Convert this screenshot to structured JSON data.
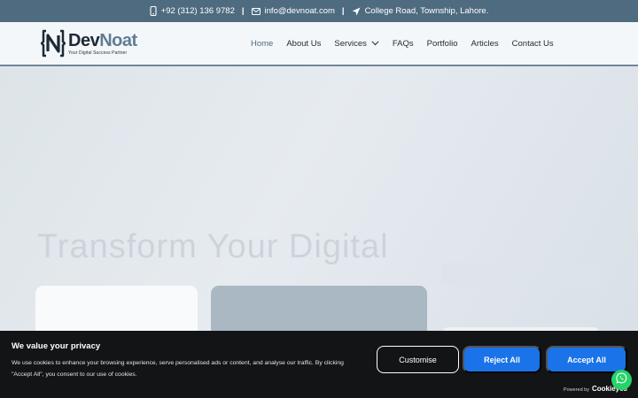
{
  "topbar": {
    "phone": "+92 (312) 136 9782",
    "email": "info@devnoat.com",
    "address": "College Road, Township, Lahore.",
    "separator": "|"
  },
  "logo": {
    "name_part1": "Dev",
    "name_part2": "Noat",
    "tagline": "Your Digital Success Partner"
  },
  "nav": {
    "items": [
      {
        "label": "Home",
        "active": true
      },
      {
        "label": "About Us"
      },
      {
        "label": "Services",
        "has_dropdown": true
      },
      {
        "label": "FAQs"
      },
      {
        "label": "Portfolio"
      },
      {
        "label": "Articles"
      },
      {
        "label": "Contact Us"
      }
    ]
  },
  "hero": {
    "title": "Transform Your Digital"
  },
  "cookie": {
    "title": "We value your privacy",
    "text": "We use cookies to enhance your browsing experience, serve personalised ads or content, and analyse our traffic. By clicking \"Accept All\", you consent to our use of cookies.",
    "customise_label": "Customise",
    "reject_label": "Reject All",
    "accept_label": "Accept All",
    "powered_by": "Powered by",
    "powered_brand": "Cookieyes"
  },
  "colors": {
    "topbar": "#4f6b80",
    "accent_button": "#1a73e8",
    "whatsapp": "#25d366",
    "banner": "#121416"
  },
  "icons": [
    "phone-icon",
    "mail-icon",
    "location-arrow-icon",
    "chevron-down-icon",
    "whatsapp-icon"
  ]
}
